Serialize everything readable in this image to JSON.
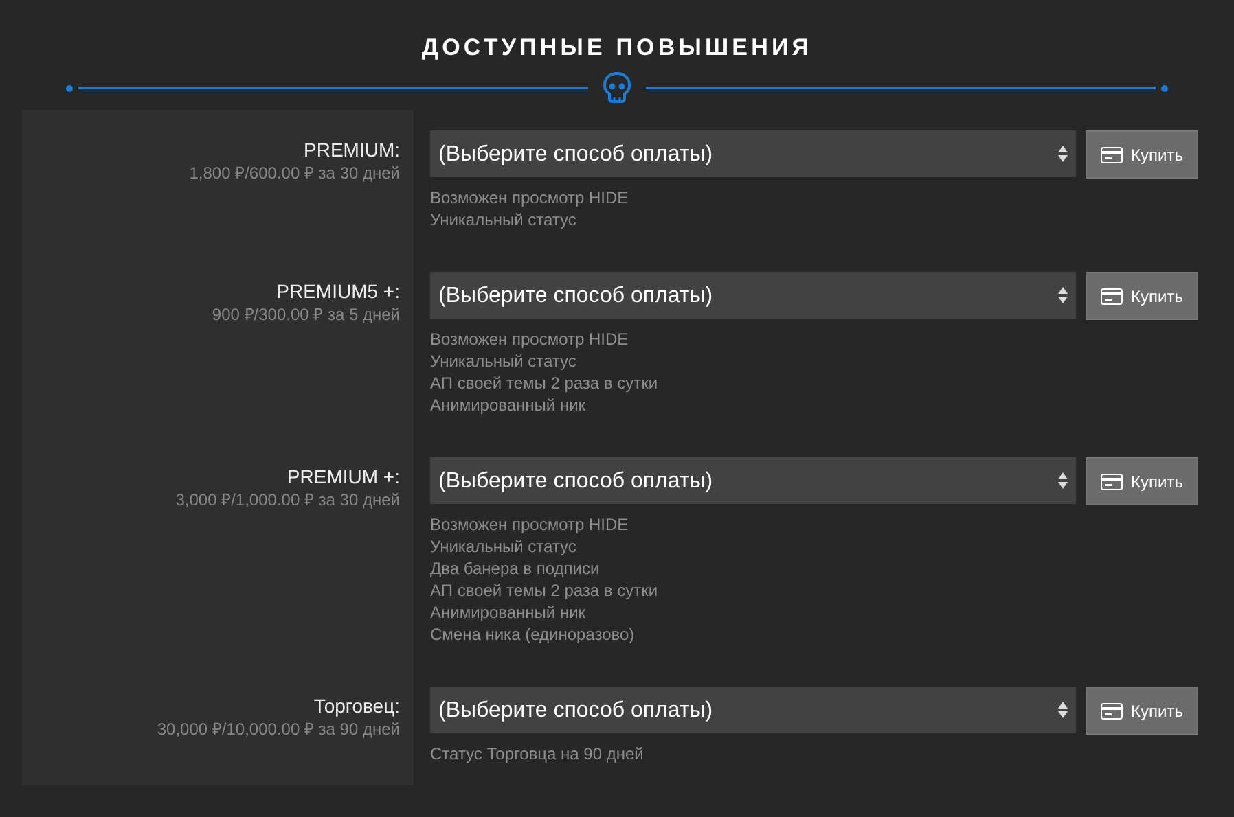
{
  "title": "ДОСТУПНЫЕ ПОВЫШЕНИЯ",
  "upgrades": [
    {
      "name": "PREMIUM:",
      "price": "1,800 ₽/600.00 ₽ за 30 дней",
      "select": "(Выберите способ оплаты)",
      "button": "Купить",
      "features": [
        "Возможен просмотр HIDE",
        "Уникальный статус"
      ]
    },
    {
      "name": "PREMIUM5 +:",
      "price": "900 ₽/300.00 ₽ за 5 дней",
      "select": "(Выберите способ оплаты)",
      "button": "Купить",
      "features": [
        "Возможен просмотр HIDE",
        "Уникальный статус",
        "АП своей темы 2 раза в сутки",
        "Анимированный ник"
      ]
    },
    {
      "name": "PREMIUM +:",
      "price": "3,000 ₽/1,000.00 ₽ за 30 дней",
      "select": "(Выберите способ оплаты)",
      "button": "Купить",
      "features": [
        "Возможен просмотр HIDE",
        "Уникальный статус",
        "Два банера в подписи",
        "АП своей темы 2 раза в сутки",
        "Анимированный ник",
        "Смена ника (единоразово)"
      ]
    },
    {
      "name": "Торговец:",
      "price": "30,000 ₽/10,000.00 ₽ за 90 дней",
      "select": "(Выберите способ оплаты)",
      "button": "Купить",
      "features": [
        "Статус Торговца на 90 дней"
      ]
    }
  ]
}
